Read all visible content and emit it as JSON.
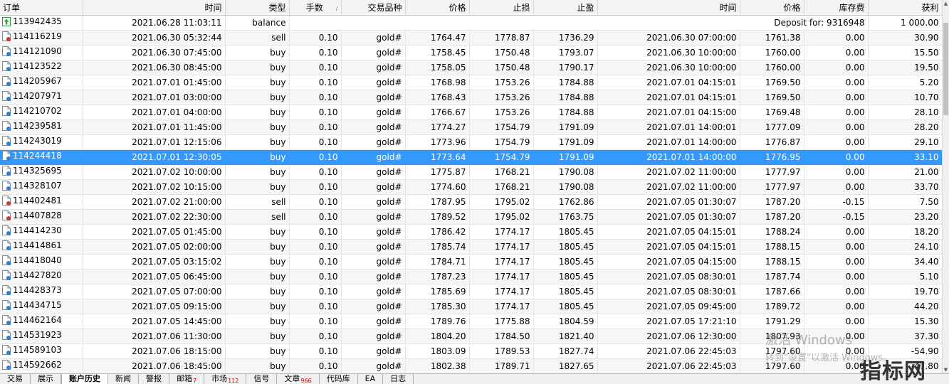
{
  "columns": [
    "订单",
    "时间",
    "类型",
    "手数",
    "交易品种",
    "价格",
    "止损",
    "止盈",
    "时间",
    "价格",
    "库存费",
    "获利"
  ],
  "balance_row": {
    "order": "113942435",
    "time": "2021.06.28 11:03:11",
    "type": "balance",
    "comment": "Deposit for: 9316948",
    "profit": "1 000.00",
    "icon": "balance-arrow-icon"
  },
  "trades": [
    {
      "order": "114116219",
      "open_time": "2021.06.30 05:32:44",
      "type": "sell",
      "lots": "0.10",
      "symbol": "gold#",
      "open_price": "1764.47",
      "sl": "1778.87",
      "tp": "1736.29",
      "close_time": "2021.06.30 07:00:00",
      "close_price": "1761.38",
      "swap": "0.00",
      "profit": "30.90"
    },
    {
      "order": "114121090",
      "open_time": "2021.06.30 07:45:00",
      "type": "buy",
      "lots": "0.10",
      "symbol": "gold#",
      "open_price": "1758.45",
      "sl": "1750.48",
      "tp": "1793.07",
      "close_time": "2021.06.30 10:00:00",
      "close_price": "1760.00",
      "swap": "0.00",
      "profit": "15.50"
    },
    {
      "order": "114123522",
      "open_time": "2021.06.30 08:45:00",
      "type": "buy",
      "lots": "0.10",
      "symbol": "gold#",
      "open_price": "1758.05",
      "sl": "1750.48",
      "tp": "1790.17",
      "close_time": "2021.06.30 10:00:00",
      "close_price": "1760.00",
      "swap": "0.00",
      "profit": "19.50"
    },
    {
      "order": "114205967",
      "open_time": "2021.07.01 01:45:00",
      "type": "buy",
      "lots": "0.10",
      "symbol": "gold#",
      "open_price": "1768.98",
      "sl": "1753.26",
      "tp": "1784.88",
      "close_time": "2021.07.01 04:15:01",
      "close_price": "1769.50",
      "swap": "0.00",
      "profit": "5.20"
    },
    {
      "order": "114207971",
      "open_time": "2021.07.01 03:00:00",
      "type": "buy",
      "lots": "0.10",
      "symbol": "gold#",
      "open_price": "1768.43",
      "sl": "1753.26",
      "tp": "1784.88",
      "close_time": "2021.07.01 04:15:01",
      "close_price": "1769.50",
      "swap": "0.00",
      "profit": "10.70"
    },
    {
      "order": "114210702",
      "open_time": "2021.07.01 04:00:00",
      "type": "buy",
      "lots": "0.10",
      "symbol": "gold#",
      "open_price": "1766.67",
      "sl": "1753.26",
      "tp": "1784.88",
      "close_time": "2021.07.01 04:15:00",
      "close_price": "1769.48",
      "swap": "0.00",
      "profit": "28.10"
    },
    {
      "order": "114239581",
      "open_time": "2021.07.01 11:45:00",
      "type": "buy",
      "lots": "0.10",
      "symbol": "gold#",
      "open_price": "1774.27",
      "sl": "1754.79",
      "tp": "1791.09",
      "close_time": "2021.07.01 14:00:01",
      "close_price": "1777.09",
      "swap": "0.00",
      "profit": "28.20"
    },
    {
      "order": "114243019",
      "open_time": "2021.07.01 12:15:06",
      "type": "buy",
      "lots": "0.10",
      "symbol": "gold#",
      "open_price": "1773.96",
      "sl": "1754.79",
      "tp": "1791.09",
      "close_time": "2021.07.01 14:00:00",
      "close_price": "1776.87",
      "swap": "0.00",
      "profit": "29.10"
    },
    {
      "order": "114244418",
      "open_time": "2021.07.01 12:30:05",
      "type": "buy",
      "lots": "0.10",
      "symbol": "gold#",
      "open_price": "1773.64",
      "sl": "1754.79",
      "tp": "1791.09",
      "close_time": "2021.07.01 14:00:00",
      "close_price": "1776.95",
      "swap": "0.00",
      "profit": "33.10",
      "selected": true
    },
    {
      "order": "114325695",
      "open_time": "2021.07.02 10:00:00",
      "type": "buy",
      "lots": "0.10",
      "symbol": "gold#",
      "open_price": "1775.87",
      "sl": "1768.21",
      "tp": "1790.08",
      "close_time": "2021.07.02 11:00:00",
      "close_price": "1777.97",
      "swap": "0.00",
      "profit": "21.00"
    },
    {
      "order": "114328107",
      "open_time": "2021.07.02 10:15:00",
      "type": "buy",
      "lots": "0.10",
      "symbol": "gold#",
      "open_price": "1774.60",
      "sl": "1768.21",
      "tp": "1790.08",
      "close_time": "2021.07.02 11:00:00",
      "close_price": "1777.97",
      "swap": "0.00",
      "profit": "33.70"
    },
    {
      "order": "114402481",
      "open_time": "2021.07.02 21:00:00",
      "type": "sell",
      "lots": "0.10",
      "symbol": "gold#",
      "open_price": "1787.95",
      "sl": "1795.02",
      "tp": "1762.86",
      "close_time": "2021.07.05 01:30:07",
      "close_price": "1787.20",
      "swap": "-0.15",
      "profit": "7.50"
    },
    {
      "order": "114407828",
      "open_time": "2021.07.02 22:30:00",
      "type": "sell",
      "lots": "0.10",
      "symbol": "gold#",
      "open_price": "1789.52",
      "sl": "1795.02",
      "tp": "1763.75",
      "close_time": "2021.07.05 01:30:07",
      "close_price": "1787.20",
      "swap": "-0.15",
      "profit": "23.20"
    },
    {
      "order": "114414230",
      "open_time": "2021.07.05 01:45:00",
      "type": "buy",
      "lots": "0.10",
      "symbol": "gold#",
      "open_price": "1786.42",
      "sl": "1774.17",
      "tp": "1805.45",
      "close_time": "2021.07.05 04:15:01",
      "close_price": "1788.24",
      "swap": "0.00",
      "profit": "18.20"
    },
    {
      "order": "114414861",
      "open_time": "2021.07.05 02:00:00",
      "type": "buy",
      "lots": "0.10",
      "symbol": "gold#",
      "open_price": "1785.74",
      "sl": "1774.17",
      "tp": "1805.45",
      "close_time": "2021.07.05 04:15:01",
      "close_price": "1788.15",
      "swap": "0.00",
      "profit": "24.10"
    },
    {
      "order": "114418040",
      "open_time": "2021.07.05 03:15:02",
      "type": "buy",
      "lots": "0.10",
      "symbol": "gold#",
      "open_price": "1784.71",
      "sl": "1774.17",
      "tp": "1805.45",
      "close_time": "2021.07.05 04:15:00",
      "close_price": "1788.15",
      "swap": "0.00",
      "profit": "34.40"
    },
    {
      "order": "114427820",
      "open_time": "2021.07.05 06:45:00",
      "type": "buy",
      "lots": "0.10",
      "symbol": "gold#",
      "open_price": "1787.23",
      "sl": "1774.17",
      "tp": "1805.45",
      "close_time": "2021.07.05 08:30:01",
      "close_price": "1787.74",
      "swap": "0.00",
      "profit": "5.10"
    },
    {
      "order": "114428373",
      "open_time": "2021.07.05 07:00:00",
      "type": "buy",
      "lots": "0.10",
      "symbol": "gold#",
      "open_price": "1785.69",
      "sl": "1774.17",
      "tp": "1805.45",
      "close_time": "2021.07.05 08:30:01",
      "close_price": "1787.66",
      "swap": "0.00",
      "profit": "19.70"
    },
    {
      "order": "114434715",
      "open_time": "2021.07.05 09:15:00",
      "type": "buy",
      "lots": "0.10",
      "symbol": "gold#",
      "open_price": "1785.30",
      "sl": "1774.17",
      "tp": "1805.45",
      "close_time": "2021.07.05 09:45:00",
      "close_price": "1789.72",
      "swap": "0.00",
      "profit": "44.20"
    },
    {
      "order": "114462164",
      "open_time": "2021.07.05 14:45:00",
      "type": "buy",
      "lots": "0.10",
      "symbol": "gold#",
      "open_price": "1789.76",
      "sl": "1775.88",
      "tp": "1804.59",
      "close_time": "2021.07.05 17:21:10",
      "close_price": "1791.29",
      "swap": "0.00",
      "profit": "15.30"
    },
    {
      "order": "114531923",
      "open_time": "2021.07.06 11:30:00",
      "type": "buy",
      "lots": "0.10",
      "symbol": "gold#",
      "open_price": "1804.20",
      "sl": "1784.50",
      "tp": "1821.40",
      "close_time": "2021.07.06 12:30:00",
      "close_price": "1807.93",
      "swap": "0.00",
      "profit": "37.30"
    },
    {
      "order": "114589103",
      "open_time": "2021.07.06 18:15:00",
      "type": "buy",
      "lots": "0.10",
      "symbol": "gold#",
      "open_price": "1803.09",
      "sl": "1789.53",
      "tp": "1827.74",
      "close_time": "2021.07.06 22:45:03",
      "close_price": "1797.60",
      "swap": "0.00",
      "profit": "-54.90"
    },
    {
      "order": "114592662",
      "open_time": "2021.07.06 18:45:00",
      "type": "buy",
      "lots": "0.10",
      "symbol": "gold#",
      "open_price": "1802.38",
      "sl": "1789.71",
      "tp": "1827.65",
      "close_time": "2021.07.06 22:45:03",
      "close_price": "1797.60",
      "swap": "0.00",
      "profit": "-47.80"
    }
  ],
  "tabs": [
    {
      "label": "交易",
      "badge": ""
    },
    {
      "label": "展示",
      "badge": ""
    },
    {
      "label": "账户历史",
      "badge": "",
      "active": true
    },
    {
      "label": "新闻",
      "badge": ""
    },
    {
      "label": "警报",
      "badge": ""
    },
    {
      "label": "邮箱",
      "badge": "7"
    },
    {
      "label": "市场",
      "badge": "112"
    },
    {
      "label": "信号",
      "badge": ""
    },
    {
      "label": "文章",
      "badge": "966"
    },
    {
      "label": "代码库",
      "badge": ""
    },
    {
      "label": "EA",
      "badge": ""
    },
    {
      "label": "日志",
      "badge": ""
    }
  ],
  "watermark": {
    "line1": "激活 Windows",
    "line2": "转到\"设置\"以激活 Windows。"
  },
  "logo_text": "指标网",
  "colors": {
    "selected_row": "#3399ff",
    "buy_icon": "#2a7fd4",
    "sell_icon": "#d9342b",
    "balance_icon": "#2e9b3a",
    "badge": "#d00000"
  }
}
